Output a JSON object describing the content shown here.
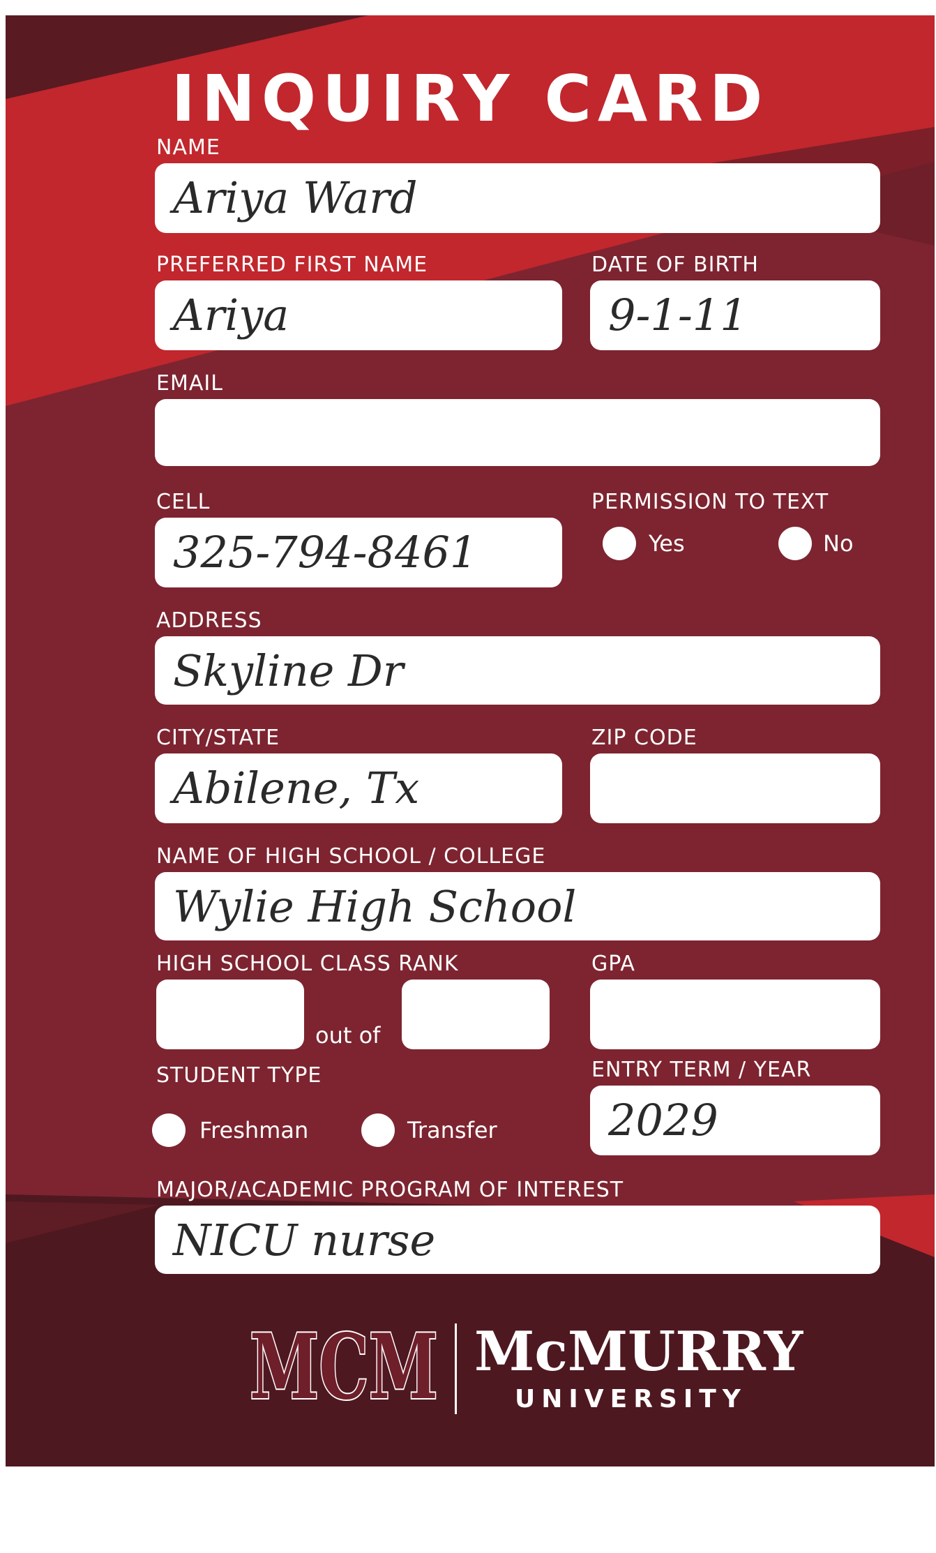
{
  "card": {
    "title": "INQUIRY CARD",
    "colors": {
      "primary": "#7d2430",
      "accent": "#c1272d",
      "dark": "#4e1820",
      "box": "#ffffff"
    }
  },
  "fields": {
    "name": {
      "label": "NAME",
      "value": "Ariya Ward"
    },
    "preferred_first_name": {
      "label": "PREFERRED FIRST NAME",
      "value": "Ariya"
    },
    "date_of_birth": {
      "label": "DATE OF BIRTH",
      "value": "9-1-11"
    },
    "email": {
      "label": "EMAIL",
      "value": ""
    },
    "cell": {
      "label": "CELL",
      "value": "325-794-8461"
    },
    "permission_to_text": {
      "label": "PERMISSION TO TEXT",
      "options": [
        "Yes",
        "No"
      ]
    },
    "address": {
      "label": "ADDRESS",
      "value": "Skyline Dr"
    },
    "city_state": {
      "label": "CITY/STATE",
      "value": "Abilene, Tx"
    },
    "zip_code": {
      "label": "ZIP CODE",
      "value": ""
    },
    "school": {
      "label": "NAME OF HIGH SCHOOL / COLLEGE",
      "value": "Wylie High School"
    },
    "class_rank": {
      "label": "HIGH SCHOOL CLASS RANK",
      "out_of": "out of",
      "rank": "",
      "total": ""
    },
    "gpa": {
      "label": "GPA",
      "value": ""
    },
    "student_type": {
      "label": "STUDENT TYPE",
      "options": [
        "Freshman",
        "Transfer"
      ]
    },
    "entry_term": {
      "label": "ENTRY TERM / YEAR",
      "value": "2029"
    },
    "major": {
      "label": "MAJOR/ACADEMIC PROGRAM OF INTEREST",
      "value": "NICU nurse"
    }
  },
  "logo": {
    "monogram": "MCM",
    "name": "McMURRY",
    "subtitle": "UNIVERSITY"
  }
}
